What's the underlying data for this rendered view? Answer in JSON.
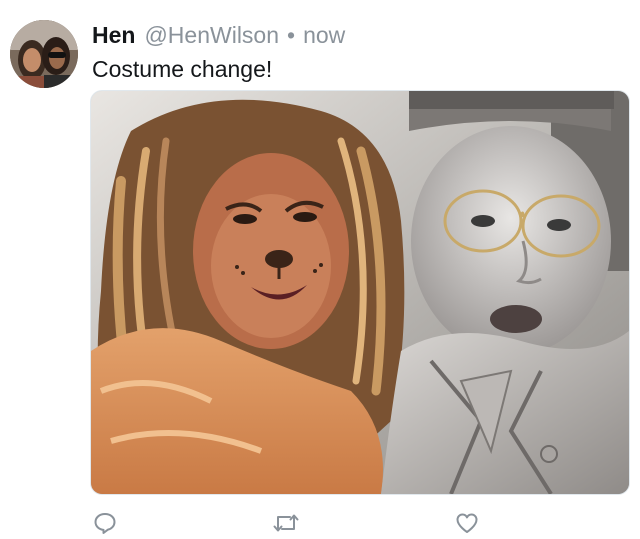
{
  "tweet": {
    "display_name": "Hen",
    "handle": "@HenWilson",
    "separator": "•",
    "timestamp": "now",
    "text": "Costume change!"
  },
  "icons": {
    "reply": "reply-bubble-icon",
    "retweet": "retweet-arrows-icon",
    "like": "heart-icon"
  },
  "colors": {
    "name_text": "#14171a",
    "secondary_text": "#8a929a",
    "icon_gray": "#8a929a"
  }
}
